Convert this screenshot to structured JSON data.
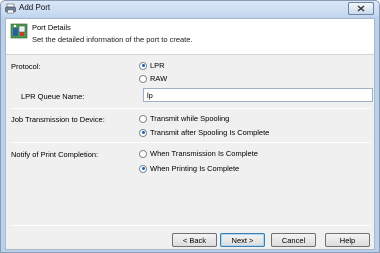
{
  "window": {
    "title": "Add Port",
    "close_icon": "close-icon"
  },
  "header": {
    "title": "Port Details",
    "description": "Set the detailed information of the port to create.",
    "icon": "printer-port-icon"
  },
  "protocol": {
    "label": "Protocol:",
    "options": [
      {
        "label": "LPR",
        "selected": true
      },
      {
        "label": "RAW",
        "selected": false
      }
    ]
  },
  "queue": {
    "label": "LPR Queue Name:",
    "value": "lp"
  },
  "transmission": {
    "label": "Job Transmission to Device:",
    "options": [
      {
        "label": "Transmit while Spooling",
        "selected": false
      },
      {
        "label": "Transmit after Spooling Is Complete",
        "selected": true
      }
    ]
  },
  "notify": {
    "label": "Notify of Print Completion:",
    "options": [
      {
        "label": "When Transmission Is Complete",
        "selected": false
      },
      {
        "label": "When Printing Is Complete",
        "selected": true
      }
    ]
  },
  "buttons": {
    "back": "< Back",
    "next": "Next >",
    "cancel": "Cancel",
    "help": "Help"
  }
}
